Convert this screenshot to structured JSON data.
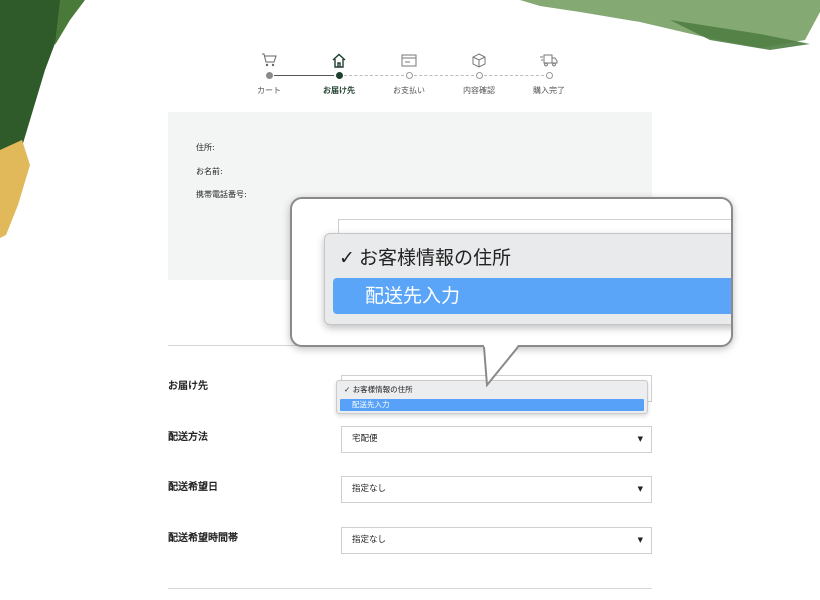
{
  "colors": {
    "brand_dark_green": "#1f3f2e",
    "select_highlight": "#57a2f8",
    "panel_bg": "#f3f4f4"
  },
  "stepper": {
    "steps": [
      {
        "label": "カート",
        "icon": "cart-icon",
        "state": "done"
      },
      {
        "label": "お届け先",
        "icon": "home-icon",
        "state": "active"
      },
      {
        "label": "お支払い",
        "icon": "payment-icon",
        "state": "upcoming"
      },
      {
        "label": "内容確認",
        "icon": "box-icon",
        "state": "upcoming"
      },
      {
        "label": "購入完了",
        "icon": "truck-icon",
        "state": "upcoming"
      }
    ]
  },
  "address_panel": {
    "address_label": "住所:",
    "name_label": "お名前:",
    "phone_label": "携帯電話番号:"
  },
  "form": {
    "destination": {
      "label": "お届け先",
      "options": [
        "お客様情報の住所",
        "配送先入力"
      ],
      "checked_option": "お客様情報の住所",
      "highlighted_option": "配送先入力"
    },
    "shipping_method": {
      "label": "配送方法",
      "value": "宅配便"
    },
    "delivery_date": {
      "label": "配送希望日",
      "value": "指定なし"
    },
    "delivery_time": {
      "label": "配送希望時間帯",
      "value": "指定なし"
    }
  },
  "callout": {
    "checkmark": "✓",
    "option_checked": "お客様情報の住所",
    "option_highlighted": "配送先入力"
  },
  "select_arrow": "▼"
}
